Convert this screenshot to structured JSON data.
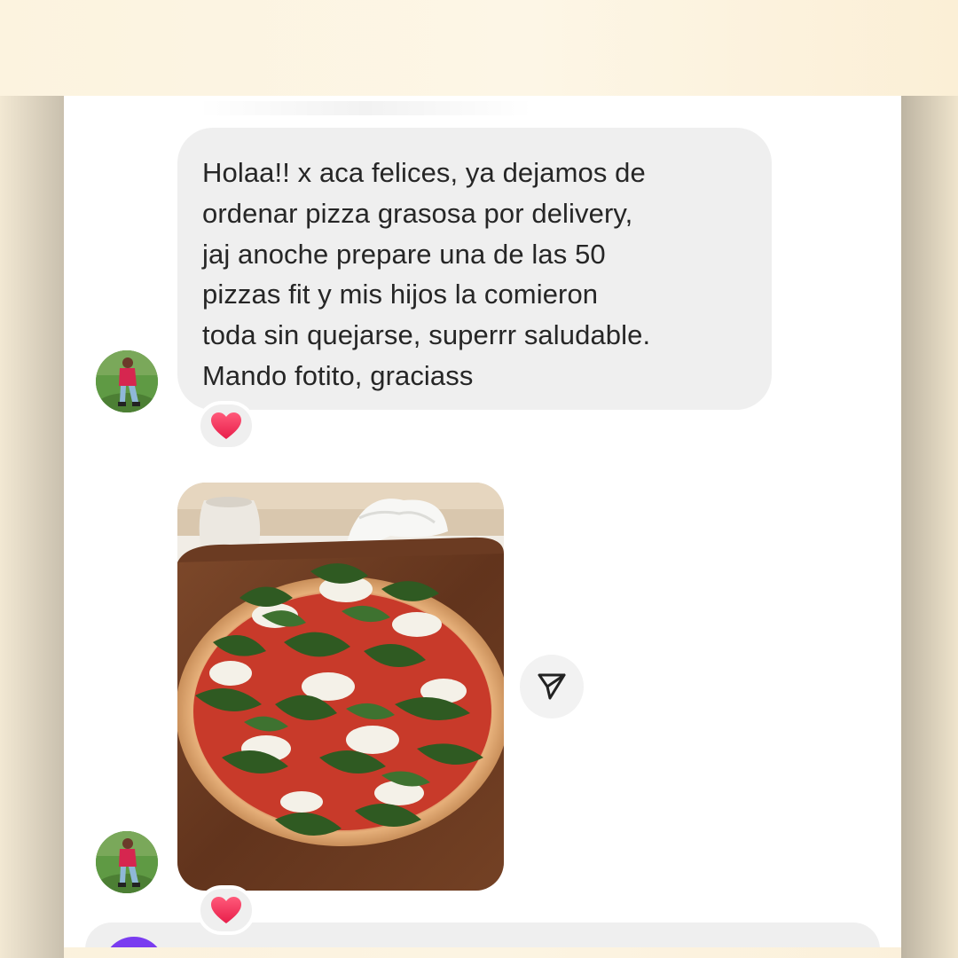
{
  "conversation": {
    "message_text": "Holaa!! x aca felices, ya dejamos de ordenar pizza grasosa por delivery, jaj anoche prepare una de las 50 pizzas fit y mis hijos la comieron toda sin quejarse, superrr saludable. Mando fotito, graciass",
    "message_lines": [
      "Holaa!! x aca felices, ya dejamos de",
      "ordenar pizza grasosa por delivery,",
      "jaj anoche prepare una de las 50",
      "pizzas fit y mis hijos la comieron",
      "toda sin quejarse, superrr saludable.",
      "Mando fotito, graciass"
    ],
    "reactions": [
      "heart-icon",
      "heart-icon"
    ],
    "photo_subject": "pizza-image",
    "share_icon": "send-icon"
  },
  "colors": {
    "bubble_bg": "#efefef",
    "text": "#262626",
    "heart": "#f0395c",
    "composer_accent": "#7a3cf0"
  }
}
